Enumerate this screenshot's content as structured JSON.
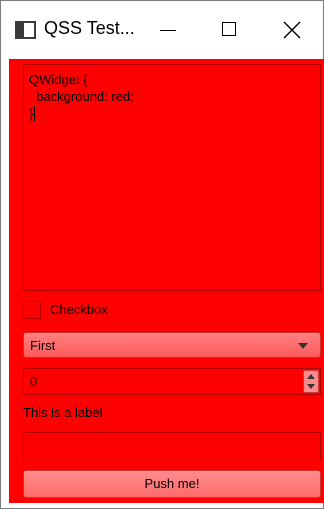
{
  "window": {
    "title": "QSS Test..."
  },
  "titlebar_buttons": {
    "minimize": "minimize-icon",
    "maximize": "maximize-icon",
    "close": "close-icon"
  },
  "colors": {
    "background": "#ff0000",
    "button_gradient_top": "#ff8d8d",
    "button_gradient_bottom": "#ff6b6b"
  },
  "editor": {
    "lines": [
      "QWidget {",
      "  background: red;",
      "}"
    ]
  },
  "checkbox": {
    "label": "Checkbox",
    "checked": false
  },
  "combo": {
    "selected": "First"
  },
  "spinbox": {
    "value": "0"
  },
  "label": {
    "text": "This is a label"
  },
  "lineedit": {
    "value": ""
  },
  "button": {
    "label": "Push me!"
  }
}
